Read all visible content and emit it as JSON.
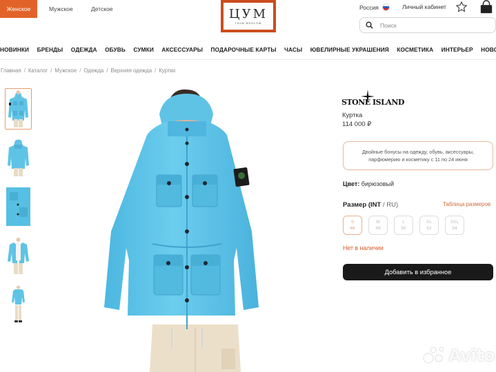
{
  "gender_tabs": [
    {
      "label": "Женское",
      "active": true
    },
    {
      "label": "Мужское",
      "active": false
    },
    {
      "label": "Детское",
      "active": false
    }
  ],
  "logo": {
    "main": "ЦУМ",
    "sub": "TSUM MOSCOW"
  },
  "header": {
    "region": "Россия",
    "account": "Личный кабинет"
  },
  "search": {
    "placeholder": "Поиск",
    "value": ""
  },
  "nav": [
    "НОВИНКИ",
    "БРЕНДЫ",
    "ОДЕЖДА",
    "ОБУВЬ",
    "СУМКИ",
    "АКСЕССУАРЫ",
    "ПОДАРОЧНЫЕ КАРТЫ",
    "ЧАСЫ",
    "ЮВЕЛИРНЫЕ УКРАШЕНИЯ",
    "КОСМЕТИКА",
    "ИНТЕРЬЕР",
    "НОВОСТИ"
  ],
  "breadcrumb": [
    "Главная",
    "Каталог",
    "Мужское",
    "Одежда",
    "Верхняя одежда",
    "Куртки"
  ],
  "product": {
    "brand": "STONE ISLAND",
    "type": "Куртка",
    "price": "114 000 ₽",
    "bonus_text": "Двойные бонусы на одежду, обувь, аксессуары, парфюмерию и косметику с 11 по 24 июня",
    "color_label": "Цвет:",
    "color_value": "бирюзовый",
    "size_label": "Размер",
    "size_int": "(INT",
    "size_ru": " / RU)",
    "size_table": "Таблица размеров",
    "sizes": [
      {
        "int": "S",
        "ru": "46",
        "selected": true
      },
      {
        "int": "M",
        "ru": "48",
        "selected": false
      },
      {
        "int": "L",
        "ru": "50",
        "selected": false
      },
      {
        "int": "XL",
        "ru": "52",
        "selected": false
      },
      {
        "int": "XXL",
        "ru": "54",
        "selected": false
      }
    ],
    "availability": "Нет в наличии",
    "favorite_button": "Добавить в избранное"
  },
  "colors": {
    "accent": "#e2632a",
    "jacket": "#5fc3e6",
    "button_dark": "#1a1a1a"
  },
  "watermark": "Avito"
}
